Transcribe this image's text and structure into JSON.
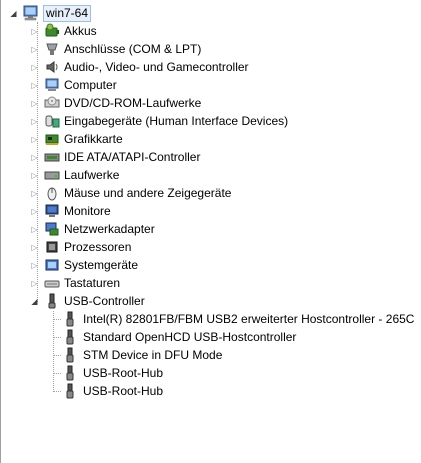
{
  "root": {
    "label": "win7-64",
    "icon": "computer-icon",
    "expanded": true
  },
  "categories": [
    {
      "label": "Akkus",
      "icon": "battery-icon"
    },
    {
      "label": "Anschlüsse (COM & LPT)",
      "icon": "port-icon"
    },
    {
      "label": "Audio-, Video- und Gamecontroller",
      "icon": "speaker-icon"
    },
    {
      "label": "Computer",
      "icon": "computer-icon"
    },
    {
      "label": "DVD/CD-ROM-Laufwerke",
      "icon": "dvd-drive-icon"
    },
    {
      "label": "Eingabegeräte (Human Interface Devices)",
      "icon": "hid-icon"
    },
    {
      "label": "Grafikkarte",
      "icon": "display-adapter-icon"
    },
    {
      "label": "IDE ATA/ATAPI-Controller",
      "icon": "ide-controller-icon"
    },
    {
      "label": "Laufwerke",
      "icon": "disk-drive-icon"
    },
    {
      "label": "Mäuse und andere Zeigegeräte",
      "icon": "mouse-icon"
    },
    {
      "label": "Monitore",
      "icon": "monitor-icon"
    },
    {
      "label": "Netzwerkadapter",
      "icon": "network-adapter-icon"
    },
    {
      "label": "Prozessoren",
      "icon": "processor-icon"
    },
    {
      "label": "Systemgeräte",
      "icon": "system-device-icon"
    },
    {
      "label": "Tastaturen",
      "icon": "keyboard-icon"
    },
    {
      "label": "USB-Controller",
      "icon": "usb-icon",
      "expanded": true
    }
  ],
  "usb_devices": [
    {
      "label": "Intel(R) 82801FB/FBM USB2 erweiterter Hostcontroller - 265C",
      "icon": "usb-plug-icon"
    },
    {
      "label": "Standard OpenHCD USB-Hostcontroller",
      "icon": "usb-plug-icon"
    },
    {
      "label": "STM Device in DFU Mode",
      "icon": "usb-plug-icon"
    },
    {
      "label": "USB-Root-Hub",
      "icon": "usb-plug-icon"
    },
    {
      "label": "USB-Root-Hub",
      "icon": "usb-plug-icon"
    }
  ],
  "expander_glyphs": {
    "collapsed": "▷",
    "expanded": "◢"
  }
}
